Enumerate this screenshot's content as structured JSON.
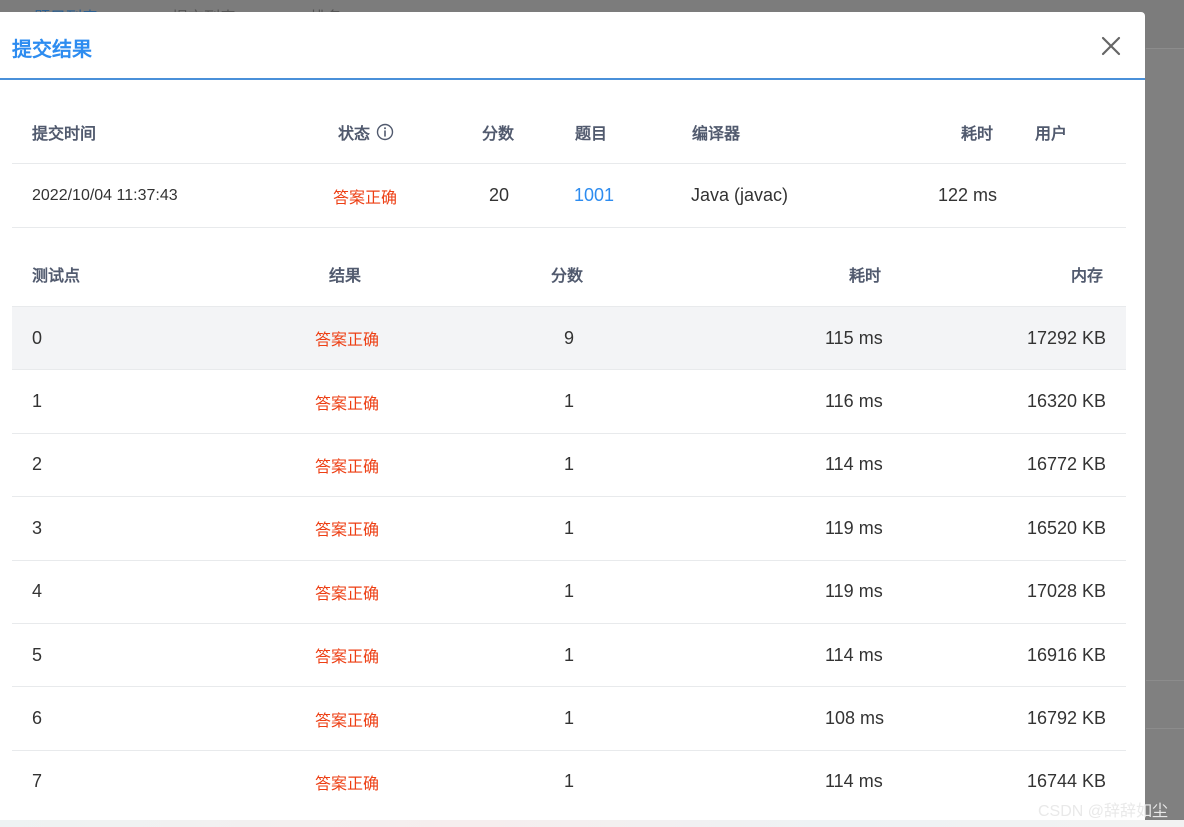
{
  "background": {
    "tabs": [
      "题目列表",
      "提交列表",
      "排名"
    ]
  },
  "dialog": {
    "title": "提交结果",
    "close_icon": "close-icon"
  },
  "summary": {
    "headers": {
      "time": "提交时间",
      "status": "状态",
      "score": "分数",
      "problem": "题目",
      "compiler": "编译器",
      "duration": "耗时",
      "user": "用户"
    },
    "row": {
      "time": "2022/10/04 11:37:43",
      "status": "答案正确",
      "score": "20",
      "problem": "1001",
      "compiler": "Java (javac)",
      "duration": "122 ms",
      "user": ""
    }
  },
  "cases": {
    "headers": {
      "id": "测试点",
      "result": "结果",
      "score": "分数",
      "duration": "耗时",
      "memory": "内存"
    },
    "rows": [
      {
        "id": "0",
        "result": "答案正确",
        "score": "9",
        "duration": "115 ms",
        "memory": "17292 KB"
      },
      {
        "id": "1",
        "result": "答案正确",
        "score": "1",
        "duration": "116 ms",
        "memory": "16320 KB"
      },
      {
        "id": "2",
        "result": "答案正确",
        "score": "1",
        "duration": "114 ms",
        "memory": "16772 KB"
      },
      {
        "id": "3",
        "result": "答案正确",
        "score": "1",
        "duration": "119 ms",
        "memory": "16520 KB"
      },
      {
        "id": "4",
        "result": "答案正确",
        "score": "1",
        "duration": "119 ms",
        "memory": "17028 KB"
      },
      {
        "id": "5",
        "result": "答案正确",
        "score": "1",
        "duration": "114 ms",
        "memory": "16916 KB"
      },
      {
        "id": "6",
        "result": "答案正确",
        "score": "1",
        "duration": "108 ms",
        "memory": "16792 KB"
      },
      {
        "id": "7",
        "result": "答案正确",
        "score": "1",
        "duration": "114 ms",
        "memory": "16744 KB"
      }
    ]
  },
  "watermark": "CSDN @辞辞如尘",
  "colors": {
    "accent": "#2d8cf0",
    "status_success_text": "#ed3f14",
    "overlay": "#808080"
  }
}
